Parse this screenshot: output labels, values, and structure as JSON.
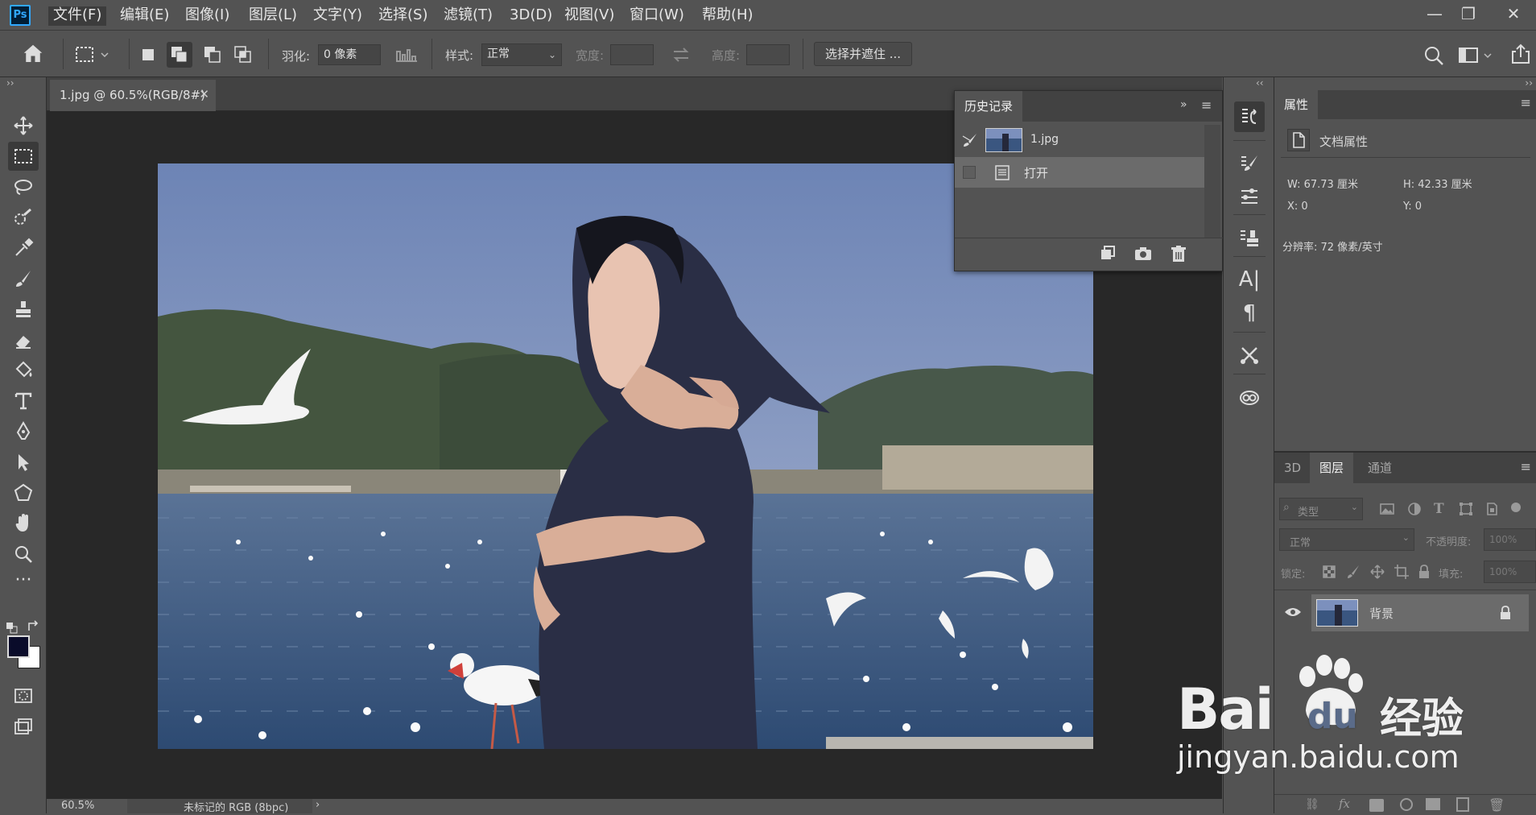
{
  "app": {
    "logo": "Ps",
    "menu": [
      "文件(F)",
      "编辑(E)",
      "图像(I)",
      "图层(L)",
      "文字(Y)",
      "选择(S)",
      "滤镜(T)",
      "3D(D)",
      "视图(V)",
      "窗口(W)",
      "帮助(H)"
    ]
  },
  "options": {
    "feather_label": "羽化:",
    "feather_value": "0 像素",
    "style_label": "样式:",
    "style_value": "正常",
    "width_label": "宽度:",
    "height_label": "高度:",
    "select_mask_label": "选择并遮住 ..."
  },
  "document": {
    "tab_title": "1.jpg @ 60.5%(RGB/8#)",
    "zoom": "60.5%",
    "status_text": "未标记的 RGB (8bpc)"
  },
  "history_panel": {
    "title": "历史记录",
    "snapshot_label": "1.jpg",
    "steps": [
      "打开"
    ]
  },
  "properties_panel": {
    "title": "属性",
    "section": "文档属性",
    "w": "W:  67.73 厘米",
    "h": "H:  42.33 厘米",
    "x": "X:  0",
    "y": "Y:  0",
    "resolution": "分辨率: 72 像素/英寸"
  },
  "layers_panel": {
    "tabs": [
      "3D",
      "图层",
      "通道"
    ],
    "kind_placeholder": "类型",
    "blend_mode": "正常",
    "opacity_label": "不透明度:",
    "opacity_value": "100%",
    "lock_label": "锁定:",
    "fill_label": "填充:",
    "fill_value": "100%",
    "layer_name": "背景"
  },
  "colors": {
    "accent": "#31a8ff",
    "foreground": "#0a0c2a",
    "background": "#ffffff"
  },
  "watermark": {
    "brand": "Bai",
    "brand2": "du",
    "cn": "经验",
    "url": "jingyan.baidu.com"
  }
}
